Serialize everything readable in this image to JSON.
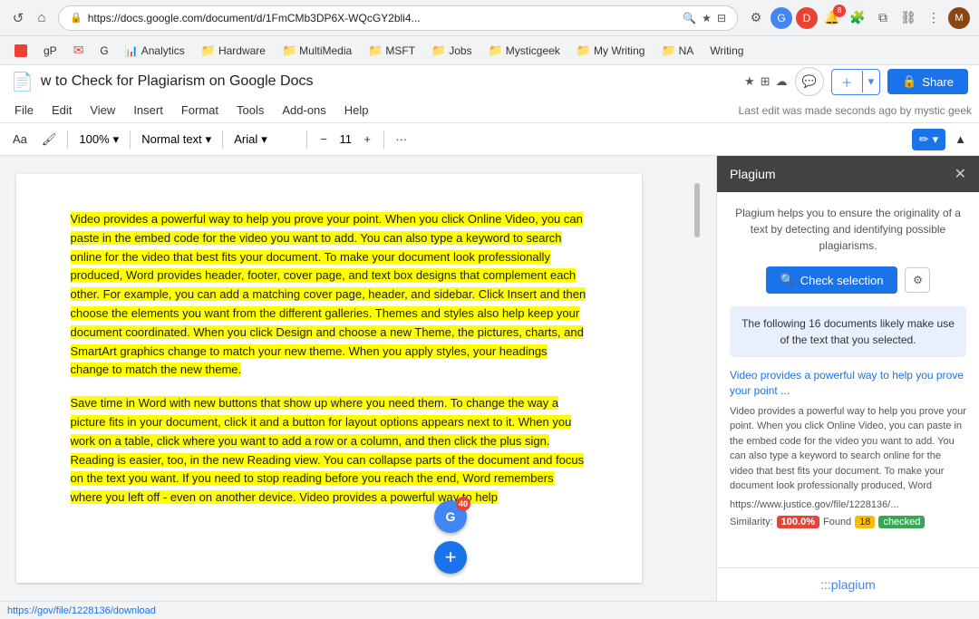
{
  "browser": {
    "url": "https://docs.google.com/document/d/1FmCMb3DP6X-WQcGY2bli4...",
    "refresh_icon": "↺",
    "home_icon": "⌂",
    "back_icon": "‹",
    "forward_icon": "›"
  },
  "bookmarks": [
    {
      "label": "gP",
      "color": "red"
    },
    {
      "label": "Analytics",
      "color": "orange"
    },
    {
      "label": "Hardware",
      "color": "folder"
    },
    {
      "label": "MultiMedia",
      "color": "folder"
    },
    {
      "label": "MSFT",
      "color": "folder"
    },
    {
      "label": "Jobs",
      "color": "folder"
    },
    {
      "label": "Mysticgeek",
      "color": "folder"
    },
    {
      "label": "My Writing",
      "color": "folder"
    },
    {
      "label": "NA",
      "color": "folder"
    }
  ],
  "doc": {
    "title": "w to Check for Plagiarism on Google Docs",
    "last_edit": "Last edit was made seconds ago by mystic geek",
    "share_label": "Share"
  },
  "menu": {
    "items": [
      "File",
      "Edit",
      "View",
      "Insert",
      "Format",
      "Tools",
      "Add-ons",
      "Help"
    ]
  },
  "toolbar": {
    "zoom": "100%",
    "style": "Normal text",
    "font": "Arial",
    "size": "11",
    "more_icon": "···"
  },
  "content": {
    "para1": "Video provides a powerful way to help you prove your point. When you click Online Video, you can paste in the embed code for the video you want to add. You can also type a keyword to search online for the video that best fits your document. To make your document look professionally produced, Word provides header, footer, cover page, and text box designs that complement each other. For example, you can add a matching cover page, header, and sidebar. Click Insert and then choose the elements you want from the different galleries. Themes and styles also help keep your document coordinated. When you click Design and choose a new Theme, the pictures, charts, and SmartArt graphics change to match your new theme. When you apply styles, your headings change to match the new theme.",
    "para2": "Save time in Word with new buttons that show up where you need them. To change the way a picture fits in your document, click it and a button for layout options appears next to it. When you work on a table, click where you want to add a row or a column, and then click the plus sign. Reading is easier, too, in the new Reading view. You can collapse parts of the document and focus on the text you want. If you need to stop reading before you reach the end, Word remembers where you left off - even on another device. Video provides a powerful way to help"
  },
  "plagium": {
    "title": "Plagium",
    "description": "Plagium helps you to ensure the originality of a text by detecting and identifying possible plagiarisms.",
    "check_btn_label": "Check selection",
    "info_text": "The following 16 documents likely make use of the text that you selected.",
    "result_link": "Video provides a powerful way to help you prove your point ...",
    "result_text": "Video provides a powerful way to help you prove your point. When you click Online Video, you can paste in the embed code for the video you want to add. You can also type a keyword to search online for the video that best fits your document. To make your document look professionally produced, Word",
    "result_url": "https://www.justice.gov/file/1228136/...",
    "similarity_label": "Similarity:",
    "similarity_value": "100.0%",
    "found_label": "Found",
    "found_value": "18",
    "checked_label": "checked",
    "footer_text": ":::plagium"
  },
  "status_bar": {
    "url": "https://gov/file/1228136/download"
  }
}
